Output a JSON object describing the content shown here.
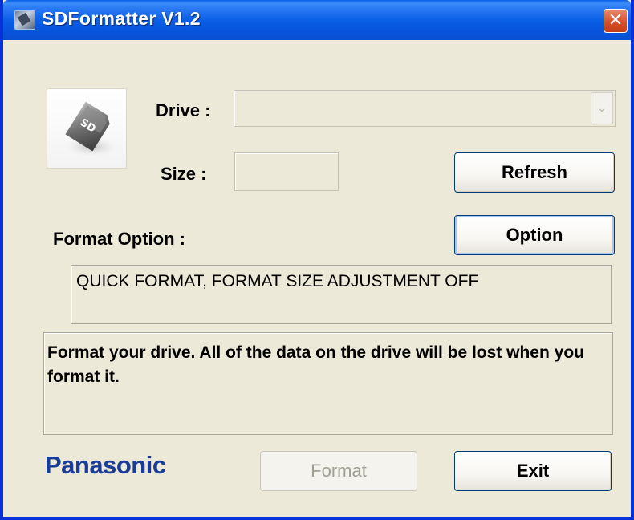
{
  "window": {
    "title": "SDFormatter V1.2",
    "close_glyph": "✕",
    "title_icon": "sd-card-icon"
  },
  "drive": {
    "label": "Drive :",
    "value": "",
    "dropdown_glyph": "⌄"
  },
  "size": {
    "label": "Size :",
    "value": ""
  },
  "buttons": {
    "refresh": "Refresh",
    "option": "Option",
    "format": "Format",
    "exit": "Exit"
  },
  "format_option": {
    "label": "Format Option :",
    "value": "QUICK FORMAT, FORMAT SIZE ADJUSTMENT OFF"
  },
  "message": "Format your drive. All of the data on the drive will be lost when you format it.",
  "brand": "Panasonic",
  "colors": {
    "titlebar": "#0b5fe6",
    "window_bg": "#ece9d8",
    "brand": "#1b3c96",
    "close": "#d8502b"
  }
}
